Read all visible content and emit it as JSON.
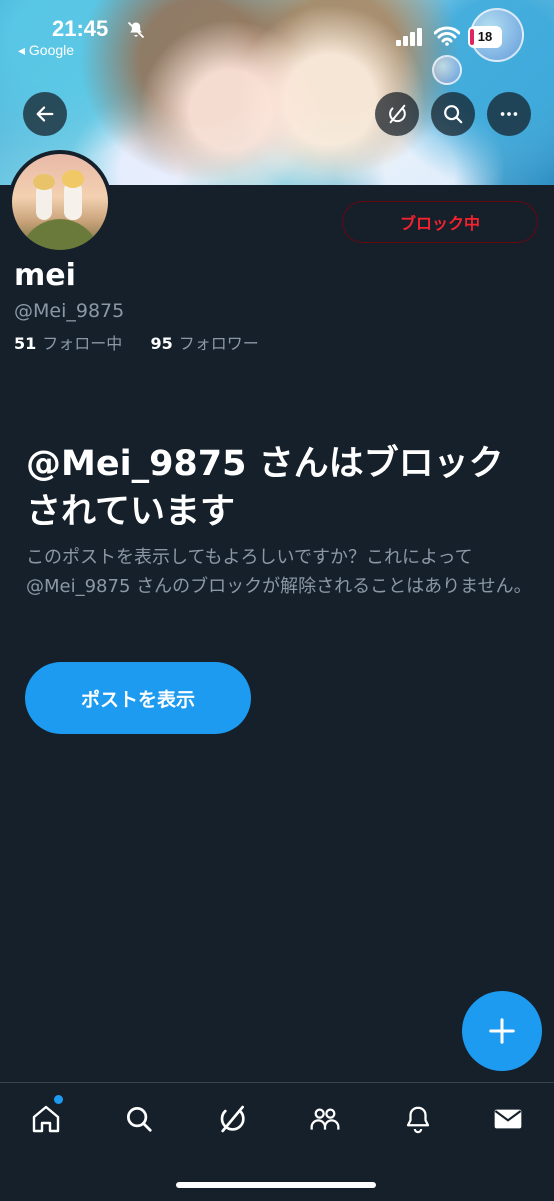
{
  "status_bar": {
    "time": "21:45",
    "back_app": "◂ Google",
    "battery": "18"
  },
  "header_buttons": [
    "back-arrow-icon",
    "grok-icon",
    "search-icon",
    "more-icon"
  ],
  "profile": {
    "block_button_label": "ブロック中",
    "name": "mei",
    "handle": "@Mei_9875",
    "following_count": "51",
    "following_label": "フォロー中",
    "followers_count": "95",
    "followers_label": "フォロワー"
  },
  "blocked_notice": {
    "title": "@Mei_9875 さんはブロックされています",
    "description": "このポストを表示してもよろしいですか？これによって@Mei_9875 さんのブロックが解除されることはありません。",
    "show_posts_label": "ポストを表示"
  },
  "tab_bar": [
    "home-icon",
    "search-icon",
    "grok-icon",
    "communities-icon",
    "notifications-icon",
    "messages-icon"
  ],
  "colors": {
    "accent": "#1d9bf0",
    "background": "#15202b",
    "blocked": "#f4212e"
  }
}
